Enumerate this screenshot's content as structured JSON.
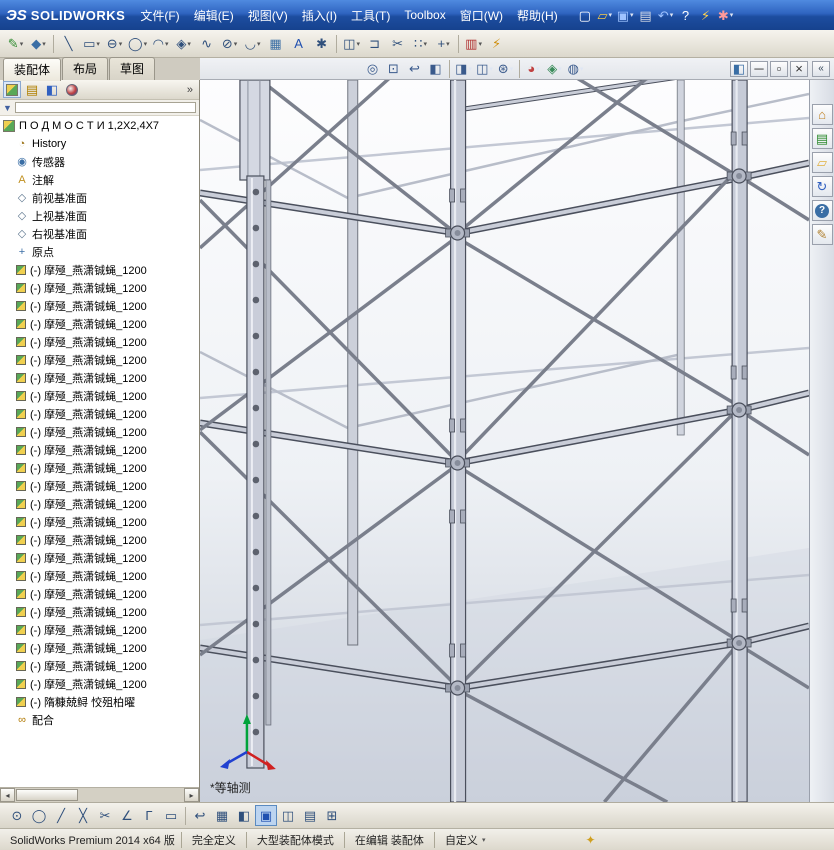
{
  "titlebar": {
    "brand_mark": "ЭS",
    "brand": "SOLIDWORKS",
    "menus": [
      "文件(F)",
      "编辑(E)",
      "视图(V)",
      "插入(I)",
      "工具(T)",
      "Toolbox",
      "窗口(W)",
      "帮助(H)"
    ],
    "quick_icons": [
      {
        "name": "new-document-icon",
        "glyph": "▢",
        "color": "#ffffff"
      },
      {
        "name": "open-icon",
        "glyph": "▱",
        "color": "#f2c84b",
        "dd": true
      },
      {
        "name": "save-icon",
        "glyph": "▣",
        "color": "#9fc3ff",
        "dd": true
      },
      {
        "name": "print-icon",
        "glyph": "▤",
        "color": "#d7dce6"
      },
      {
        "name": "undo-icon",
        "glyph": "↶",
        "color": "#9fc3ff",
        "dd": true
      },
      {
        "name": "help-icon",
        "glyph": "?",
        "color": "#ffffff"
      },
      {
        "name": "rebuild-icon",
        "glyph": "⚡",
        "color": "#ffd34d"
      },
      {
        "name": "options-icon",
        "glyph": "✱",
        "color": "#ff9a9a",
        "dd": true
      }
    ]
  },
  "sketch_toolbar": {
    "icons": [
      {
        "name": "sketch-icon",
        "glyph": "✎",
        "color": "#2e8b2e",
        "dd": true
      },
      {
        "name": "smart-dimension-icon",
        "glyph": "◆",
        "color": "#3a6ea5",
        "dd": true
      },
      {
        "sep": true
      },
      {
        "name": "line-icon",
        "glyph": "╲",
        "color": "#30507c"
      },
      {
        "name": "rectangle-icon",
        "glyph": "▭",
        "color": "#30507c",
        "dd": true
      },
      {
        "name": "slot-icon",
        "glyph": "⊖",
        "color": "#30507c",
        "dd": true
      },
      {
        "name": "circle-icon",
        "glyph": "◯",
        "color": "#30507c",
        "dd": true
      },
      {
        "name": "arc-icon",
        "glyph": "◠",
        "color": "#30507c",
        "dd": true
      },
      {
        "name": "polygon-icon",
        "glyph": "◈",
        "color": "#30507c",
        "dd": true
      },
      {
        "name": "spline-icon",
        "glyph": "∿",
        "color": "#30507c"
      },
      {
        "name": "ellipse-icon",
        "glyph": "⊘",
        "color": "#30507c",
        "dd": true
      },
      {
        "name": "fillet-icon",
        "glyph": "◡",
        "color": "#30507c",
        "dd": true
      },
      {
        "name": "plane-icon",
        "glyph": "▦",
        "color": "#3a6ea5"
      },
      {
        "name": "text-icon",
        "glyph": "A",
        "color": "#2050b0"
      },
      {
        "name": "point-icon",
        "glyph": "✱",
        "color": "#30507c"
      },
      {
        "sep": true
      },
      {
        "name": "mirror-entities-icon",
        "glyph": "◫",
        "color": "#30507c",
        "dd": true
      },
      {
        "name": "offset-entities-icon",
        "glyph": "⊐",
        "color": "#30507c"
      },
      {
        "name": "trim-entities-icon",
        "glyph": "✂",
        "color": "#30507c"
      },
      {
        "name": "linear-pattern-icon",
        "glyph": "∷",
        "color": "#30507c",
        "dd": true
      },
      {
        "name": "move-entities-icon",
        "glyph": "+",
        "color": "#30507c",
        "dd": true
      },
      {
        "sep": true
      },
      {
        "name": "toolbox-icon",
        "glyph": "▥",
        "color": "#b03030",
        "dd": true
      },
      {
        "name": "rebuild-flash-icon",
        "glyph": "⚡",
        "color": "#d09010"
      }
    ]
  },
  "strip": {
    "collapse_glyph": "«",
    "hud_icons": [
      {
        "name": "zoom-to-fit-icon",
        "glyph": "◎",
        "color": "#3a5a8c"
      },
      {
        "name": "zoom-to-area-icon",
        "glyph": "⊡",
        "color": "#3a5a8c"
      },
      {
        "name": "previous-view-icon",
        "glyph": "↩",
        "color": "#3a5a8c"
      },
      {
        "name": "section-view-icon",
        "glyph": "◧",
        "color": "#3a5a8c"
      },
      {
        "sep": true
      },
      {
        "name": "view-orientation-icon",
        "glyph": "◨",
        "color": "#3a5a8c",
        "dd": true
      },
      {
        "name": "display-style-icon",
        "glyph": "◫",
        "color": "#3a5a8c",
        "dd": true
      },
      {
        "name": "hide-show-items-icon",
        "glyph": "⊛",
        "color": "#3a5a8c",
        "dd": true
      },
      {
        "sep": true
      },
      {
        "name": "edit-appearance-icon",
        "glyph": "◕",
        "color": "#c04040",
        "dd": true
      },
      {
        "name": "apply-scene-icon",
        "glyph": "◈",
        "color": "#3a8c5a",
        "dd": true
      },
      {
        "name": "view-settings-icon",
        "glyph": "◍",
        "color": "#3a5a8c",
        "dd": true
      }
    ],
    "doc_controls": [
      {
        "name": "display-pane-icon",
        "glyph": "◧",
        "color": "#3a6ea5"
      },
      {
        "name": "document-minimize-button",
        "glyph": "─",
        "color": "#333"
      },
      {
        "name": "document-restore-button",
        "glyph": "▫",
        "color": "#333"
      },
      {
        "name": "document-close-button",
        "glyph": "×",
        "color": "#333"
      }
    ]
  },
  "panel": {
    "tabs": [
      "装配体",
      "布局",
      "草图"
    ],
    "header_icons": [
      {
        "name": "featuremanager-tab-icon",
        "cls": "asm-icon",
        "pressed": true
      },
      {
        "name": "propertymanager-tab-icon",
        "glyph": "▤",
        "color": "#b08000"
      },
      {
        "name": "configurationmanager-tab-icon",
        "glyph": "◧",
        "color": "#3060c0"
      },
      {
        "name": "displaymanager-tab-icon",
        "cls": "ball-icon"
      }
    ],
    "overflow_glyph": "»"
  },
  "tree": {
    "root": "П О Д М О С Т И 1,2X2,4X7",
    "special_items": [
      {
        "icon": "history",
        "label": "History",
        "glyph": "◔",
        "color": "#a07820"
      },
      {
        "icon": "sensors",
        "label": "传感器",
        "glyph": "◉",
        "color": "#3a6ea5"
      },
      {
        "icon": "annotations",
        "label": "注解",
        "glyph": "A",
        "color": "#c09020"
      },
      {
        "icon": "front-plane",
        "label": "前视基准面",
        "glyph": "◇",
        "color": "#607890"
      },
      {
        "icon": "top-plane",
        "label": "上视基准面",
        "glyph": "◇",
        "color": "#607890"
      },
      {
        "icon": "right-plane",
        "label": "右视基准面",
        "glyph": "◇",
        "color": "#607890"
      },
      {
        "icon": "origin",
        "label": "原点",
        "glyph": "+",
        "color": "#3a6ea5"
      }
    ],
    "components": [
      "(-) 摩殛_燕潇铖蝇_1200",
      "(-) 摩殛_燕潇铖蝇_1200",
      "(-) 摩殛_燕潇铖蝇_1200",
      "(-) 摩殛_燕潇铖蝇_1200",
      "(-) 摩殛_燕潇铖蝇_1200",
      "(-) 摩殛_燕潇铖蝇_1200",
      "(-) 摩殛_燕潇铖蝇_1200",
      "(-) 摩殛_燕潇铖蝇_1200",
      "(-) 摩殛_燕潇铖蝇_1200",
      "(-) 摩殛_燕潇铖蝇_1200",
      "(-) 摩殛_燕潇铖蝇_1200",
      "(-) 摩殛_燕潇铖蝇_1200",
      "(-) 摩殛_燕潇铖蝇_1200",
      "(-) 摩殛_燕潇铖蝇_1200",
      "(-) 摩殛_燕潇铖蝇_1200",
      "(-) 摩殛_燕潇铖蝇_1200",
      "(-) 摩殛_燕潇铖蝇_1200",
      "(-) 摩殛_燕潇铖蝇_1200",
      "(-) 摩殛_燕潇铖蝇_1200",
      "(-) 摩殛_燕潇铖蝇_1200",
      "(-) 摩殛_燕潇铖蝇_1200",
      "(-) 摩殛_燕潇铖蝇_1200",
      "(-) 摩殛_燕潇铖蝇_1200",
      "(-) 摩殛_燕潇铖蝇_1200",
      "(-) 隋糠兢鲟 恔殂柏曜"
    ],
    "mates": "配合"
  },
  "viewport": {
    "view_label": "*等轴测"
  },
  "task_pane": {
    "icons": [
      {
        "name": "solidworks-resources-icon",
        "glyph": "⌂",
        "color": "#c08020"
      },
      {
        "name": "design-library-icon",
        "glyph": "▤",
        "color": "#2e8b2e"
      },
      {
        "name": "file-explorer-icon",
        "glyph": "▱",
        "color": "#e0b040"
      },
      {
        "name": "view-palette-icon",
        "glyph": "↻",
        "color": "#3060c0"
      },
      {
        "name": "appearances-scenes-icon",
        "glyph": "?",
        "color": "#ffffff",
        "bg": "#3a6ea5"
      },
      {
        "name": "custom-properties-icon",
        "glyph": "✎",
        "color": "#b08030"
      }
    ]
  },
  "bottom_toolbar": {
    "icons": [
      {
        "name": "point-tool-icon",
        "glyph": "⊙",
        "color": "#30507c"
      },
      {
        "name": "circle-tool-icon",
        "glyph": "◯",
        "color": "#30507c"
      },
      {
        "name": "line-tool-icon",
        "glyph": "╱",
        "color": "#30507c"
      },
      {
        "name": "cross-tool-icon",
        "glyph": "╳",
        "color": "#30507c"
      },
      {
        "name": "trim-tool-icon",
        "glyph": "✂",
        "color": "#30507c"
      },
      {
        "name": "angle-tool-icon",
        "glyph": "∠",
        "color": "#30507c"
      },
      {
        "name": "corner-tool-icon",
        "glyph": "Γ",
        "color": "#30507c"
      },
      {
        "name": "rect-tool-icon",
        "glyph": "▭",
        "color": "#30507c"
      },
      {
        "sep": true
      },
      {
        "name": "exit-sketch-icon",
        "glyph": "↩",
        "color": "#30507c"
      },
      {
        "name": "grid-icon",
        "glyph": "▦",
        "color": "#30507c"
      },
      {
        "name": "shaded-view-icon",
        "glyph": "◧",
        "color": "#30507c"
      },
      {
        "name": "single-view-button",
        "glyph": "▣",
        "color": "#2050b0",
        "active": true
      },
      {
        "name": "two-view-button",
        "glyph": "◫",
        "color": "#30507c"
      },
      {
        "name": "horizontal-split-view-button",
        "glyph": "▤",
        "color": "#30507c"
      },
      {
        "name": "four-view-button",
        "glyph": "⊞",
        "color": "#30507c"
      }
    ]
  },
  "statusbar": {
    "product": "SolidWorks Premium 2014 x64 版",
    "defined": "完全定义",
    "mode": "大型装配体模式",
    "editing": "在编辑 装配体",
    "custom": "自定义",
    "status_icon_glyph": "✦"
  }
}
